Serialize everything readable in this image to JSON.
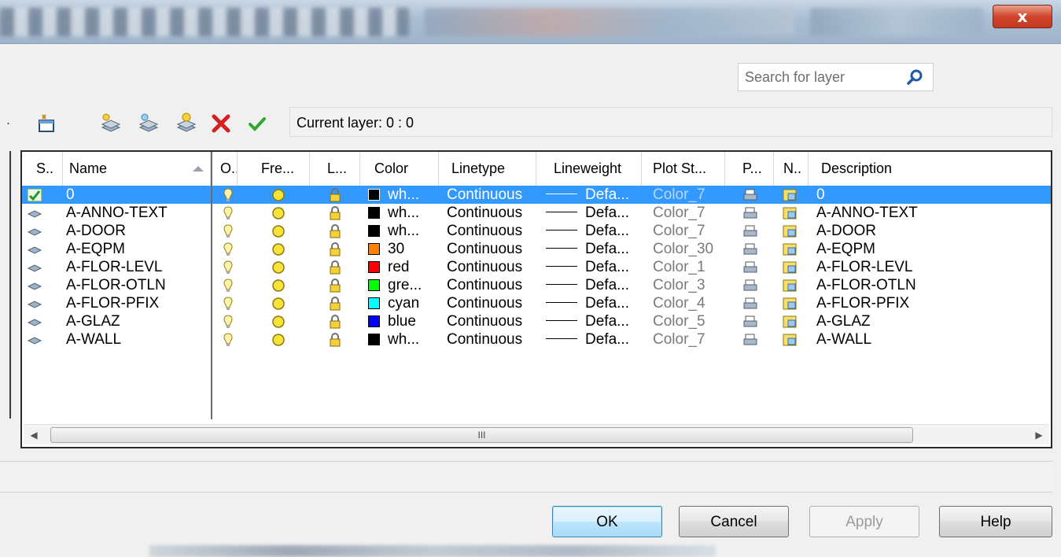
{
  "window": {
    "close_label": "x"
  },
  "search": {
    "placeholder": "Search for layer"
  },
  "toolbar": {
    "current_layer_label": "Current layer: 0 : 0",
    "icons": [
      "new-property-filter-icon",
      "new-layer-icon",
      "new-layer-vp-frozen-icon",
      "new-layer-all-vp-frozen-icon",
      "delete-layer-icon",
      "set-current-icon"
    ]
  },
  "columns": [
    "S..",
    "Name",
    "O..",
    "Fre...",
    "L...",
    "Color",
    "Linetype",
    "Lineweight",
    "Plot St...",
    "P...",
    "N..",
    "Description"
  ],
  "layers": [
    {
      "name": "0",
      "color_name": "wh...",
      "color_hex": "#000000",
      "linetype": "Continuous",
      "lineweight": "Defa...",
      "plot_style": "Color_7",
      "description": "0",
      "current": true
    },
    {
      "name": "A-ANNO-TEXT",
      "color_name": "wh...",
      "color_hex": "#000000",
      "linetype": "Continuous",
      "lineweight": "Defa...",
      "plot_style": "Color_7",
      "description": "A-ANNO-TEXT",
      "current": false
    },
    {
      "name": "A-DOOR",
      "color_name": "wh...",
      "color_hex": "#000000",
      "linetype": "Continuous",
      "lineweight": "Defa...",
      "plot_style": "Color_7",
      "description": "A-DOOR",
      "current": false
    },
    {
      "name": "A-EQPM",
      "color_name": "30",
      "color_hex": "#ff7f00",
      "linetype": "Continuous",
      "lineweight": "Defa...",
      "plot_style": "Color_30",
      "description": "A-EQPM",
      "current": false
    },
    {
      "name": "A-FLOR-LEVL",
      "color_name": "red",
      "color_hex": "#ff0000",
      "linetype": "Continuous",
      "lineweight": "Defa...",
      "plot_style": "Color_1",
      "description": "A-FLOR-LEVL",
      "current": false
    },
    {
      "name": "A-FLOR-OTLN",
      "color_name": "gre...",
      "color_hex": "#00ff00",
      "linetype": "Continuous",
      "lineweight": "Defa...",
      "plot_style": "Color_3",
      "description": "A-FLOR-OTLN",
      "current": false
    },
    {
      "name": "A-FLOR-PFIX",
      "color_name": "cyan",
      "color_hex": "#00ffff",
      "linetype": "Continuous",
      "lineweight": "Defa...",
      "plot_style": "Color_4",
      "description": "A-FLOR-PFIX",
      "current": false
    },
    {
      "name": "A-GLAZ",
      "color_name": "blue",
      "color_hex": "#0000ff",
      "linetype": "Continuous",
      "lineweight": "Defa...",
      "plot_style": "Color_5",
      "description": "A-GLAZ",
      "current": false
    },
    {
      "name": "A-WALL",
      "color_name": "wh...",
      "color_hex": "#000000",
      "linetype": "Continuous",
      "lineweight": "Defa...",
      "plot_style": "Color_7",
      "description": "A-WALL",
      "current": false
    }
  ],
  "scrollbar": {
    "grip": "III"
  },
  "buttons": {
    "ok": "OK",
    "cancel": "Cancel",
    "apply": "Apply",
    "help": "Help"
  },
  "colors": {
    "selection": "#3399ff",
    "accent_check": "#2fa82f",
    "delete": "#d42020"
  }
}
